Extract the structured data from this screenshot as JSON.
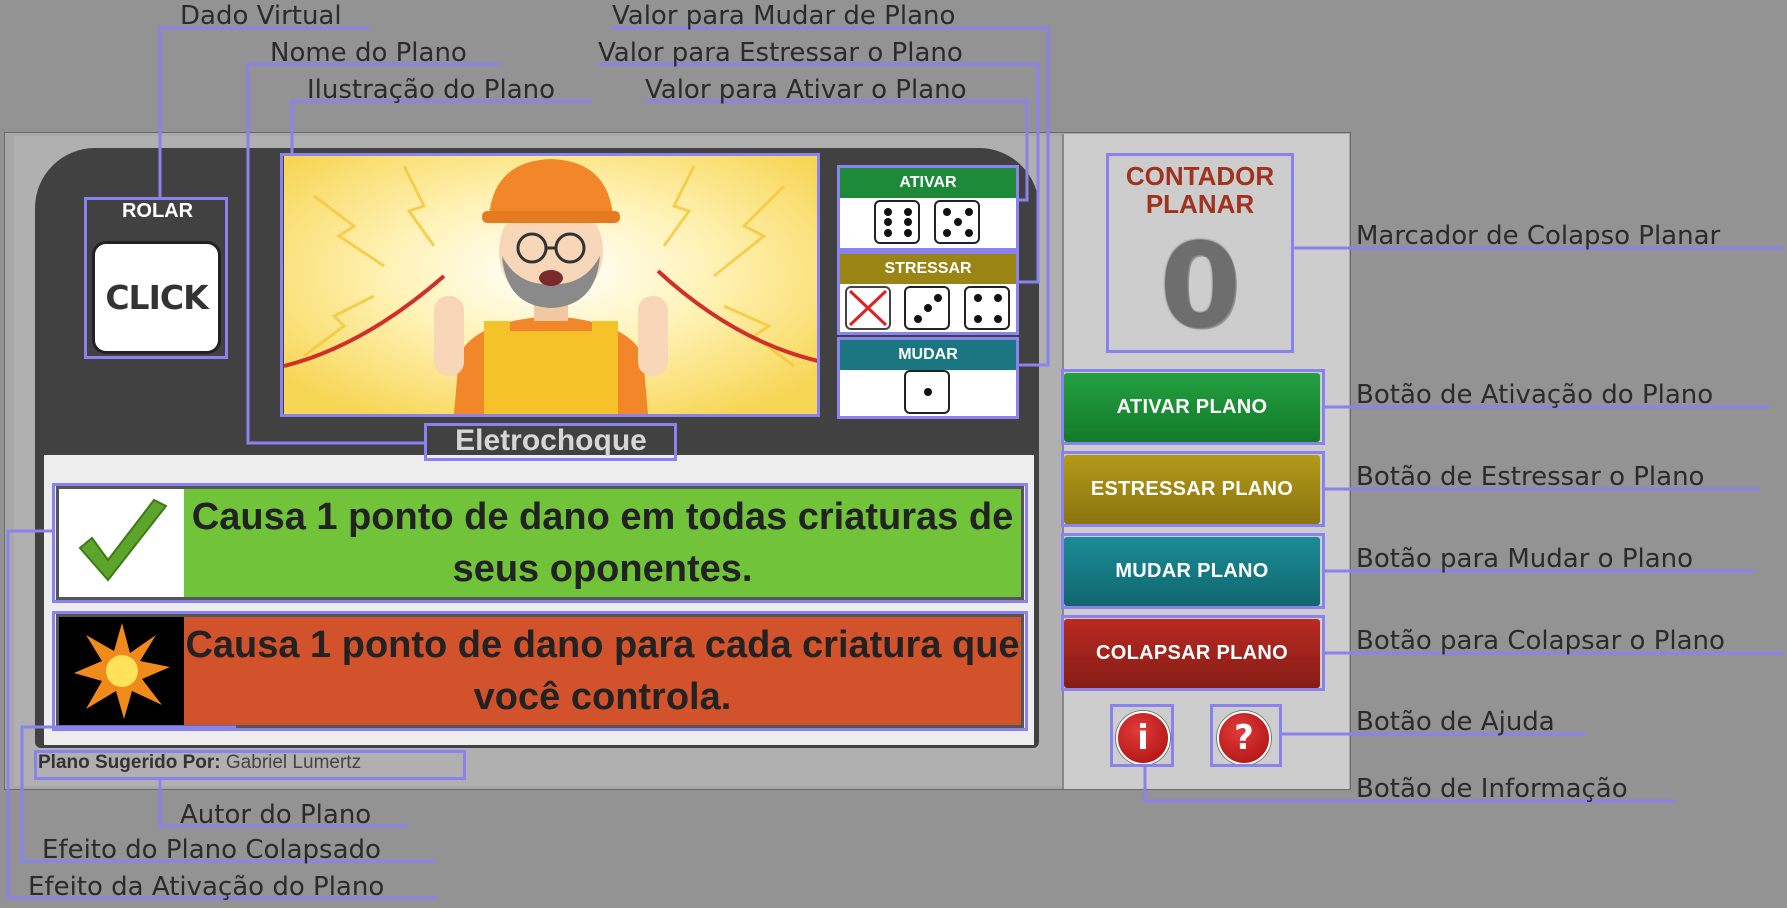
{
  "callouts": {
    "dado_virtual": "Dado Virtual",
    "nome_do_plano": "Nome do Plano",
    "ilustracao_do_plano": "Ilustração do Plano",
    "valor_mudar": "Valor para Mudar de Plano",
    "valor_estressar": "Valor para Estressar o Plano",
    "valor_ativar": "Valor para Ativar o Plano",
    "marcador_colapso": "Marcador de Colapso Planar",
    "botao_ativacao": "Botão de Ativação do Plano",
    "botao_estressar": "Botão de Estressar o Plano",
    "botao_mudar": "Botão para Mudar o Plano",
    "botao_colapsar": "Botão para Colapsar o Plano",
    "botao_ajuda": "Botão de Ajuda",
    "botao_informacao": "Botão de Informação",
    "autor_do_plano": "Autor do Plano",
    "efeito_colapsado": "Efeito do Plano Colapsado",
    "efeito_ativacao": "Efeito da Ativação do Plano"
  },
  "dice": {
    "rolar_label": "ROLAR",
    "click_label": "CLICK"
  },
  "values": {
    "ativar": {
      "label": "ATIVAR",
      "color": "#1d8a3a",
      "faces": [
        6,
        5
      ]
    },
    "stressar": {
      "label": "STRESSAR",
      "color": "#9a8413",
      "faces": [
        "X",
        3,
        4
      ]
    },
    "mudar": {
      "label": "MUDAR",
      "color": "#1a7680",
      "faces": [
        1
      ]
    }
  },
  "plane": {
    "name": "Eletrochoque",
    "activation_effect": "Causa 1 ponto de dano em todas criaturas de seus oponentes.",
    "collapse_effect": "Causa 1 ponto de dano para cada criatura que você controla.",
    "author_label": "Plano Sugerido Por:",
    "author_name": "Gabriel Lumertz",
    "activation_color": "#71c33a",
    "collapse_color": "#d2532b"
  },
  "counter": {
    "title_line1": "CONTADOR",
    "title_line2": "PLANAR",
    "value": "0"
  },
  "buttons": {
    "ativar": "ATIVAR PLANO",
    "estressar": "ESTRESSAR PLANO",
    "mudar": "MUDAR PLANO",
    "colapsar": "COLAPSAR PLANO",
    "info": "i",
    "help": "?"
  }
}
